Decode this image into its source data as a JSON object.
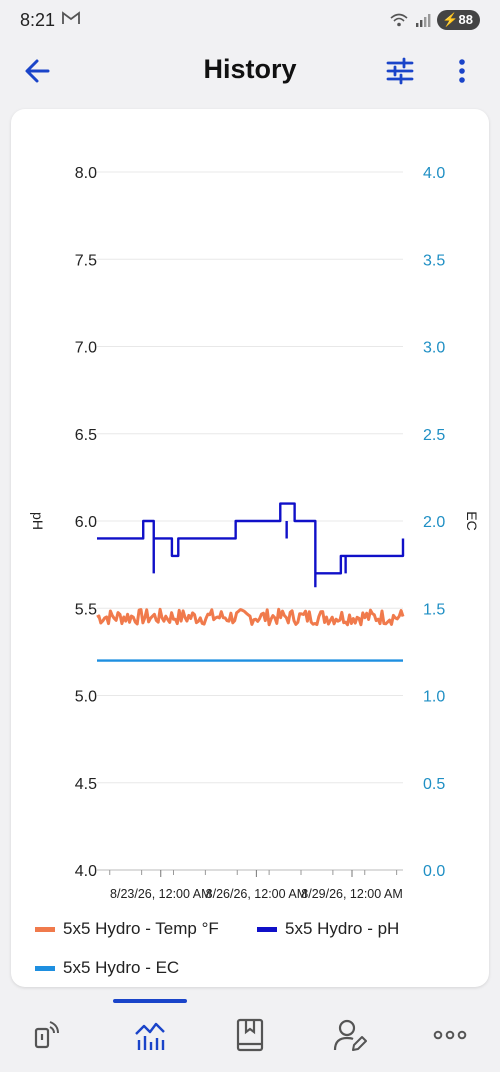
{
  "status_bar": {
    "time": "8:21",
    "mail_icon": "gmail-icon",
    "battery": "88"
  },
  "header": {
    "title": "History",
    "back_icon": "back-arrow-icon",
    "filter_icon": "sliders-icon",
    "more_icon": "more-vert-icon"
  },
  "colors": {
    "ph": "#1010c8",
    "temp": "#f07a4c",
    "ec": "#1e8fe0",
    "right_axis": "#1f8fc4",
    "accent": "#1a44c9"
  },
  "chart_data": {
    "type": "line",
    "x_ticks": [
      "8/23/26, 12:00 AM",
      "8/26/26, 12:00 AM",
      "8/29/26, 12:00 AM"
    ],
    "x_tick_days": [
      2,
      5,
      8
    ],
    "x_range": [
      0,
      9.6
    ],
    "ylabel": "pH",
    "ylim": [
      4.0,
      8.0
    ],
    "y_ticks": [
      "4.0",
      "4.5",
      "5.0",
      "5.5",
      "6.0",
      "6.5",
      "7.0",
      "7.5",
      "8.0"
    ],
    "y2label": "EC",
    "y2lim": [
      0.0,
      4.0
    ],
    "y2_ticks": [
      "0.0",
      "0.5",
      "1.0",
      "1.5",
      "2.0",
      "2.5",
      "3.0",
      "3.5",
      "4.0"
    ],
    "series": [
      {
        "name": "5x5 Hydro - Temp °F",
        "axis": "left",
        "noise": true,
        "x": [
          0,
          9.6
        ],
        "y": [
          5.45,
          5.45
        ]
      },
      {
        "name": "5x5 Hydro - pH",
        "axis": "left",
        "step": true,
        "x": [
          0,
          1.45,
          1.78,
          2.35,
          2.55,
          4.35,
          5.75,
          6.2,
          6.85,
          7.65,
          9.6
        ],
        "y": [
          5.9,
          6.0,
          5.9,
          5.8,
          5.9,
          6.0,
          6.1,
          6.0,
          5.7,
          5.8,
          5.9
        ]
      },
      {
        "name": "5x5 Hydro - EC",
        "axis": "right",
        "x": [
          0,
          9.6
        ],
        "y": [
          1.2,
          1.2
        ]
      }
    ],
    "grid": "horizontal",
    "legend": "bottom"
  },
  "bottom_nav": {
    "items": [
      {
        "name": "devices",
        "icon": "device-wifi-icon"
      },
      {
        "name": "history",
        "icon": "chart-icon",
        "active": true
      },
      {
        "name": "journal",
        "icon": "bookmark-book-icon"
      },
      {
        "name": "profile",
        "icon": "user-edit-icon"
      },
      {
        "name": "more",
        "icon": "more-horiz-icon"
      }
    ]
  }
}
